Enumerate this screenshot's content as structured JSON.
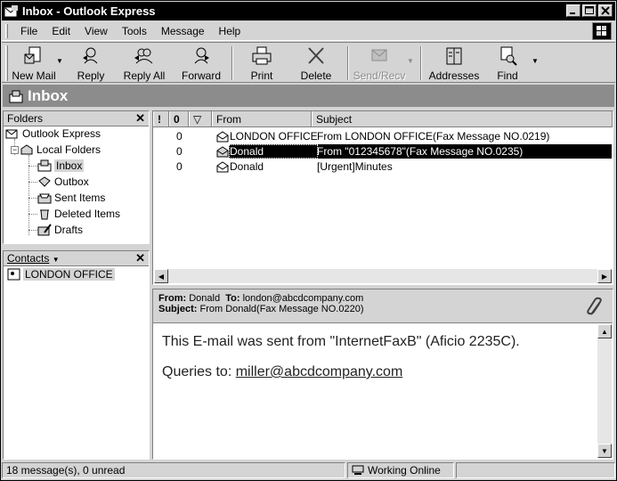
{
  "window": {
    "title": "Inbox - Outlook Express"
  },
  "menu": [
    "File",
    "Edit",
    "View",
    "Tools",
    "Message",
    "Help"
  ],
  "toolbar": {
    "new_mail": "New Mail",
    "reply": "Reply",
    "reply_all": "Reply All",
    "forward": "Forward",
    "print": "Print",
    "delete": "Delete",
    "send_recv": "Send/Recv",
    "addresses": "Addresses",
    "find": "Find"
  },
  "banner": {
    "title": "Inbox"
  },
  "folders": {
    "header": "Folders",
    "items": [
      "Outlook Express",
      "Local Folders",
      "Inbox",
      "Outbox",
      "Sent Items",
      "Deleted Items",
      "Drafts"
    ]
  },
  "contacts": {
    "header": "Contacts",
    "items": [
      "LONDON OFFICE"
    ]
  },
  "message_list": {
    "columns": [
      "!",
      "0",
      "▽",
      "From",
      "Subject"
    ],
    "rows": [
      {
        "attachment": "0",
        "from": "LONDON OFFICE",
        "subject": "From LONDON OFFICE(Fax Message NO.0219)",
        "selected": false
      },
      {
        "attachment": "0",
        "from": "Donald",
        "subject": "From \"012345678\"(Fax Message NO.0235)",
        "selected": true
      },
      {
        "attachment": "0",
        "from": "Donald",
        "subject": "[Urgent]Minutes",
        "selected": false
      }
    ]
  },
  "preview": {
    "from_label": "From:",
    "from": "Donald",
    "to_label": "To:",
    "to": "london@abcdcompany.com",
    "subject_label": "Subject:",
    "subject": "From Donald(Fax Message NO.0220)",
    "body_line1": "This E-mail was sent from \"InternetFaxB\" (Aficio 2235C).",
    "body_line2_prefix": "Queries to: ",
    "body_link": "miller@abcdcompany.com"
  },
  "status": {
    "count": "18 message(s), 0 unread",
    "online": "Working Online"
  }
}
